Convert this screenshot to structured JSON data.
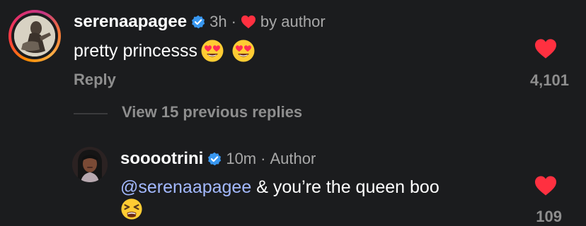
{
  "comments": [
    {
      "username": "serenaapagee",
      "time": "3h",
      "separator": "·",
      "liked_by_label": "by author",
      "text": "pretty princesss",
      "emojis": [
        "heart-eyes-emoji",
        "heart-eyes-emoji"
      ],
      "reply_label": "Reply",
      "like_count": "4,101",
      "liked": true
    },
    {
      "username": "sooootrini",
      "time": "10m",
      "separator": "·",
      "author_label": "Author",
      "mention": "@serenaapagee",
      "text": " & you’re the queen boo",
      "emojis": [
        "tired-face-emoji"
      ],
      "like_count": "109",
      "liked": true
    }
  ],
  "view_replies_label": "View 15 previous replies",
  "colors": {
    "background": "#1b1c1e",
    "heart": "#ff3040",
    "verified": "#3897f0",
    "muted": "#8e8e8e",
    "mention": "#a3b9ff"
  }
}
